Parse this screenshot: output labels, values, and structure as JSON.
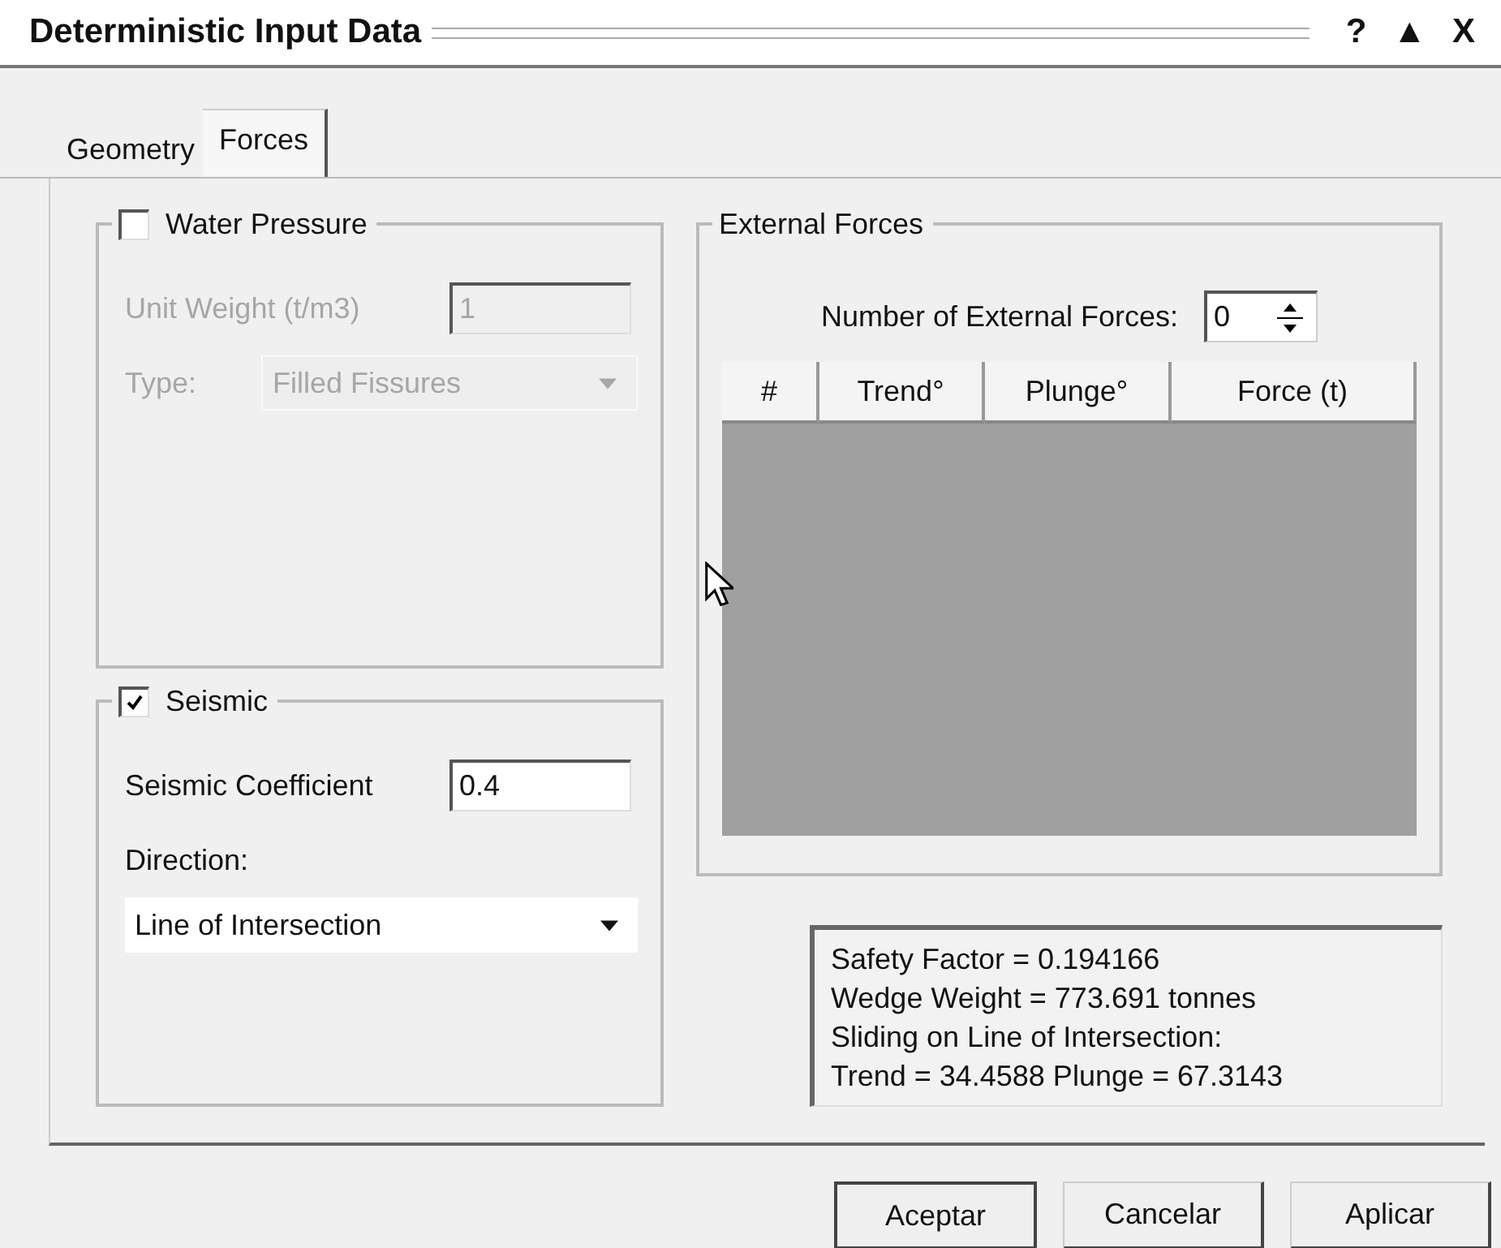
{
  "window": {
    "title": "Deterministic Input Data",
    "controls": [
      "?",
      "▲",
      "X"
    ]
  },
  "tabs": [
    {
      "label": "Geometry",
      "selected": false
    },
    {
      "label": "Forces",
      "selected": true
    }
  ],
  "water_pressure": {
    "label": "Water Pressure",
    "checked": false,
    "unit_weight_label": "Unit Weight (t/m3)",
    "unit_weight": "1",
    "type_label": "Type:",
    "type": "Filled Fissures"
  },
  "seismic": {
    "label": "Seismic",
    "checked": true,
    "coefficient_label": "Seismic Coefficient",
    "coefficient": "0.4",
    "direction_label": "Direction:",
    "direction": "Line of Intersection"
  },
  "external_forces": {
    "label": "External Forces",
    "count_label": "Number of External Forces:",
    "count": "0",
    "columns": [
      "#",
      "Trend°",
      "Plunge°",
      "Force (t)"
    ]
  },
  "results": [
    "Safety Factor = 0.194166",
    "Wedge Weight = 773.691 tonnes",
    "Sliding on Line of Intersection:",
    "Trend = 34.4588 Plunge = 67.3143"
  ],
  "buttons": [
    "Aceptar",
    "Cancelar",
    "Aplicar"
  ]
}
